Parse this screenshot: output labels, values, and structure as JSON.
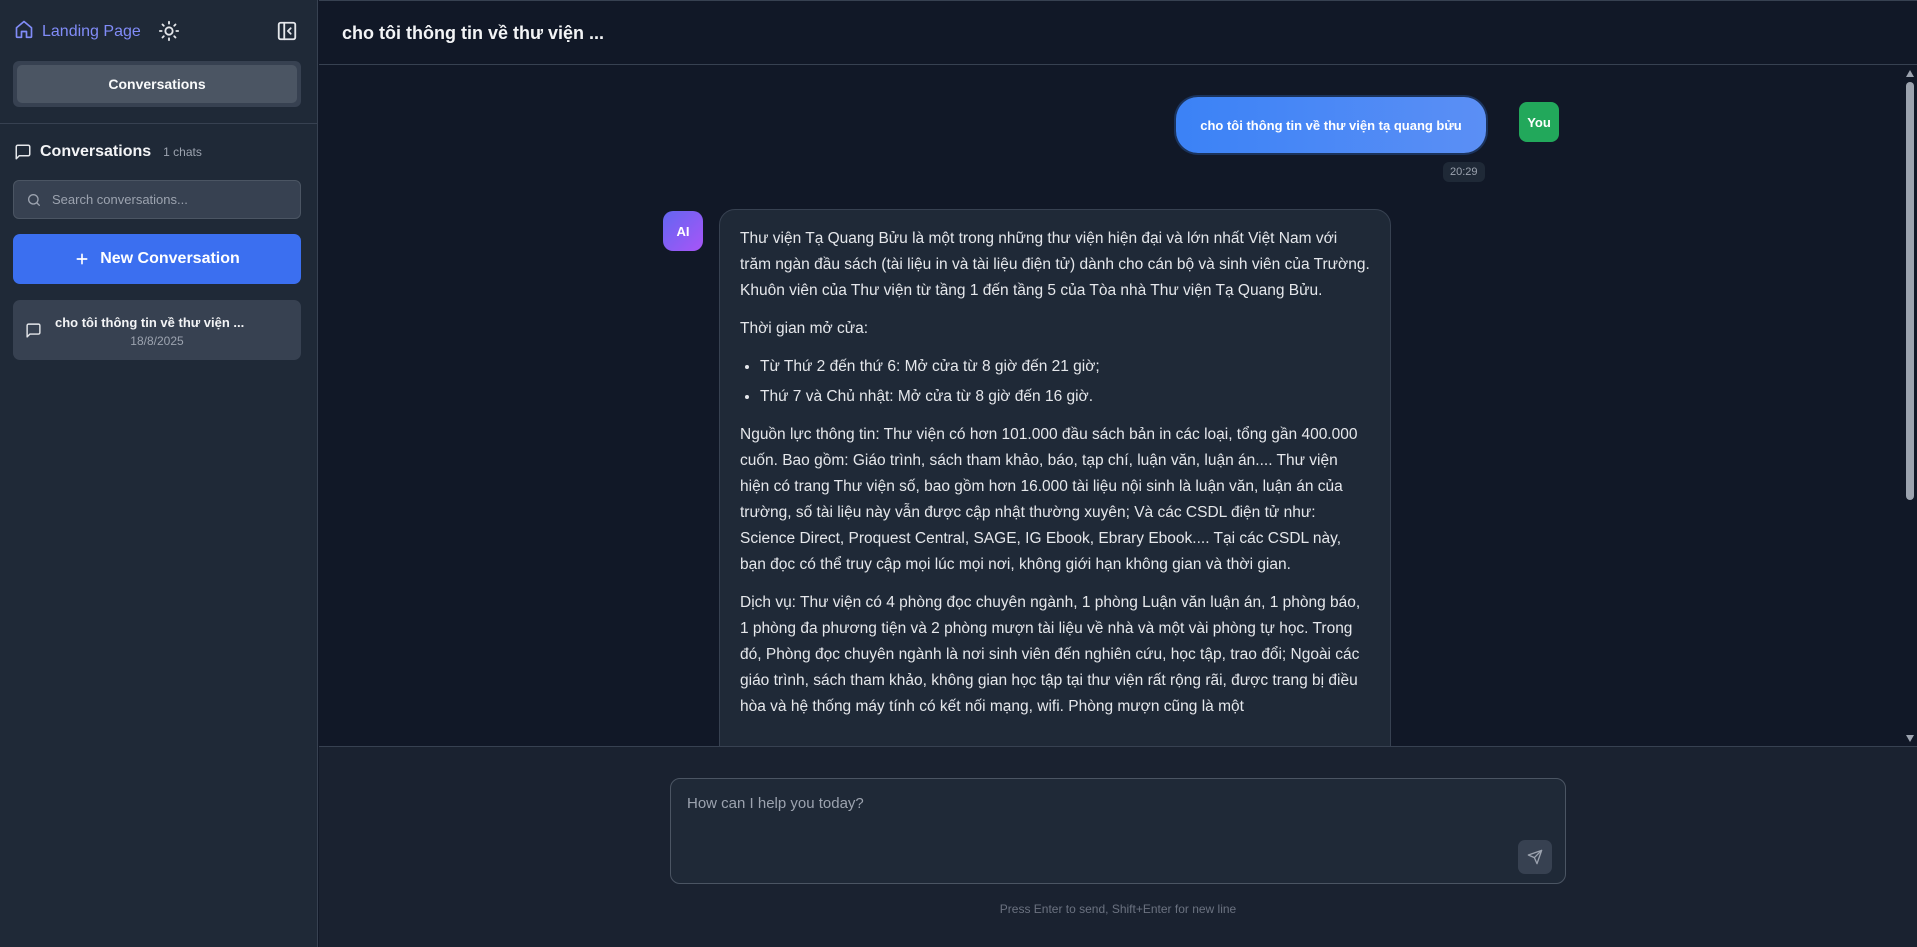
{
  "sidebar": {
    "brand_label": "Landing Page",
    "segment_label": "Conversations",
    "conversations_title": "Conversations",
    "conversations_count": "1 chats",
    "search_placeholder": "Search conversations...",
    "new_conversation_label": "New Conversation",
    "items": [
      {
        "title": "cho tôi thông tin về thư viện ...",
        "date": "18/8/2025"
      }
    ]
  },
  "header": {
    "title": "cho tôi thông tin về thư viện ..."
  },
  "messages": {
    "user": {
      "avatar": "You",
      "text": "cho tôi thông tin về thư viện tạ quang bửu",
      "time": "20:29"
    },
    "ai": {
      "avatar": "AI",
      "p1": "Thư viện Tạ Quang Bửu là một trong những thư viện hiện đại và lớn nhất Việt Nam với trăm ngàn đầu sách (tài liệu in và tài liệu điện tử) dành cho cán bộ và sinh viên của Trường. Khuôn viên của Thư viện từ tầng 1 đến tầng 5 của Tòa nhà Thư viện Tạ Quang Bửu.",
      "p2": "Thời gian mở cửa:",
      "li1": "Từ Thứ 2 đến thứ 6: Mở cửa từ 8 giờ đến 21 giờ;",
      "li2": "Thứ 7 và Chủ nhật: Mở cửa từ 8 giờ đến 16 giờ.",
      "p3": "Nguồn lực thông tin: Thư viện có hơn 101.000 đầu sách bản in các loại, tổng gần 400.000 cuốn. Bao gồm: Giáo trình, sách tham khảo, báo, tạp chí, luận văn, luận án.... Thư viện hiện có trang Thư viện số, bao gồm hơn 16.000 tài liệu nội sinh là luận văn, luận án của trường, số tài liệu này vẫn được cập nhật thường xuyên; Và các CSDL điện tử như: Science Direct, Proquest Central, SAGE, IG Ebook, Ebrary Ebook.... Tại các CSDL này, bạn đọc có thể truy cập mọi lúc mọi nơi, không giới hạn không gian và thời gian.",
      "p4": "Dịch vụ: Thư viện có 4 phòng đọc chuyên ngành, 1 phòng Luận văn luận án, 1 phòng báo, 1 phòng đa phương tiện và 2 phòng mượn tài liệu về nhà và một vài phòng tự học. Trong đó, Phòng đọc chuyên ngành là nơi sinh viên đến nghiên cứu, học tập, trao đổi; Ngoài các giáo trình, sách tham khảo, không gian học tập tại thư viện rất rộng rãi, được trang bị điều hòa và hệ thống máy tính có kết nối mạng, wifi. Phòng mượn cũng là một"
    }
  },
  "composer": {
    "placeholder": "How can I help you today?",
    "hint": "Press Enter to send, Shift+Enter for new line"
  },
  "icons": {
    "home": "home-icon",
    "theme": "sun-icon",
    "collapse": "sidebar-collapse-icon",
    "chat": "chat-bubble-icon",
    "search": "search-icon",
    "plus": "plus-icon",
    "send": "send-icon"
  },
  "colors": {
    "accent": "#3b6ff0",
    "brand": "#818cf8",
    "user_avatar": "#22a85b",
    "bg": "#111827",
    "sidebar_bg": "#1f2937"
  }
}
